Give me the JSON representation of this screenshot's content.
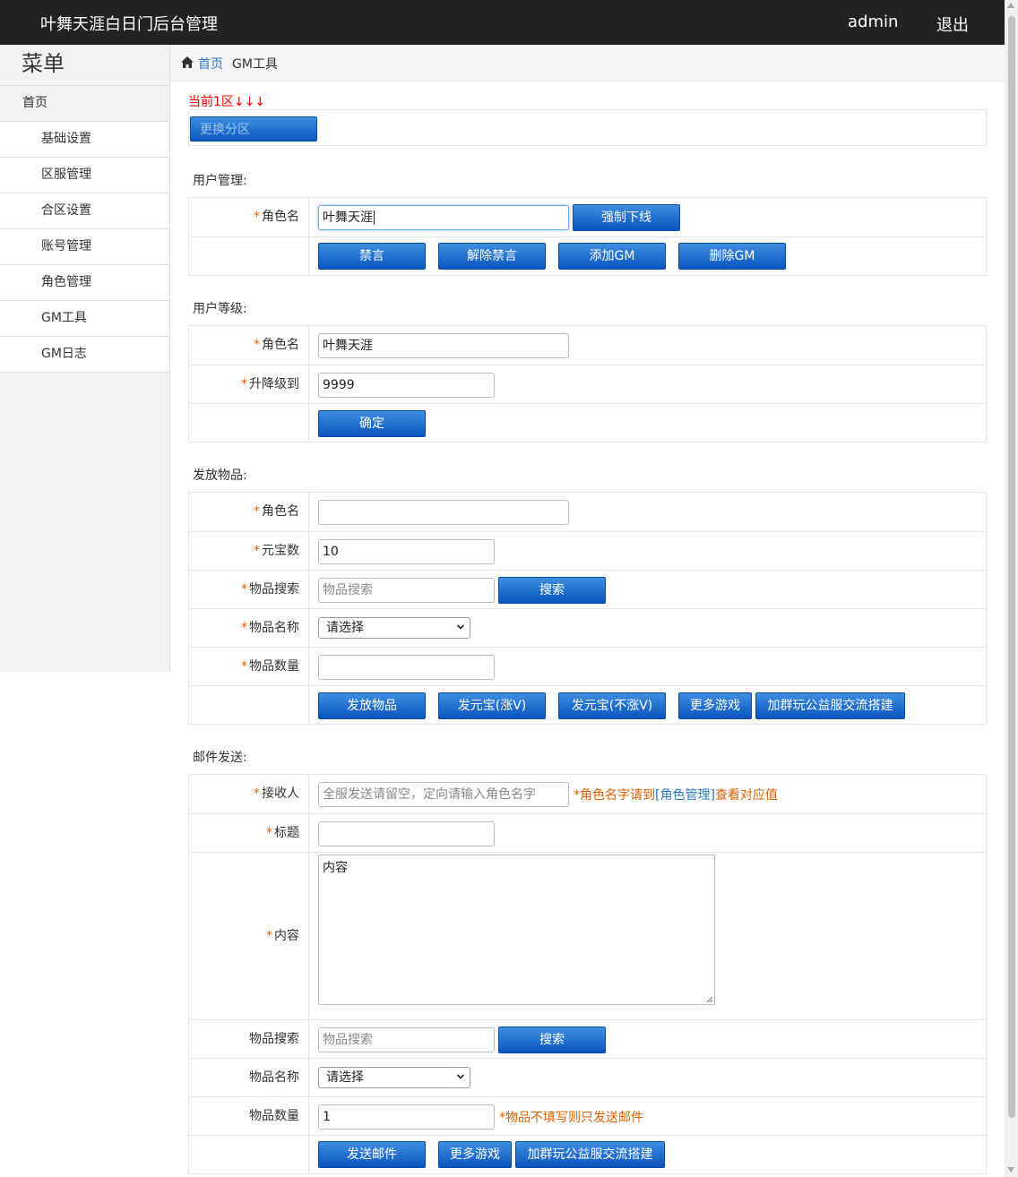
{
  "header": {
    "title": "叶舞天涯白日门后台管理",
    "user": "admin",
    "logout": "退出"
  },
  "sidebar": {
    "title": "菜单",
    "items": [
      {
        "label": "首页"
      },
      {
        "label": "基础设置"
      },
      {
        "label": "区服管理"
      },
      {
        "label": "合区设置"
      },
      {
        "label": "账号管理"
      },
      {
        "label": "角色管理"
      },
      {
        "label": "GM工具"
      },
      {
        "label": "GM日志"
      }
    ]
  },
  "breadcrumb": {
    "home": "首页",
    "current": "GM工具"
  },
  "zone": {
    "note": "当前1区↓↓↓",
    "button": "更换分区"
  },
  "user_mgmt": {
    "title": "用户管理:",
    "role_label": "角色名",
    "role_value": "叶舞天涯",
    "kick_button": "强制下线",
    "buttons": [
      "禁言",
      "解除禁言",
      "添加GM",
      "删除GM"
    ]
  },
  "user_level": {
    "title": "用户等级:",
    "role_label": "角色名",
    "role_value": "叶舞天涯",
    "level_label": "升降级到",
    "level_value": "9999",
    "confirm_button": "确定"
  },
  "items": {
    "title": "发放物品:",
    "role_label": "角色名",
    "role_value": "",
    "yb_label": "元宝数",
    "yb_value": "10",
    "search_label": "物品搜索",
    "search_placeholder": "物品搜索",
    "search_button": "搜索",
    "name_label": "物品名称",
    "name_select": "请选择",
    "qty_label": "物品数量",
    "qty_value": "",
    "buttons": [
      "发放物品",
      "发元宝(涨V)",
      "发元宝(不涨V)",
      "更多游戏",
      "加群玩公益服交流搭建"
    ]
  },
  "mail": {
    "title": "邮件发送:",
    "recipient_label": "接收人",
    "recipient_placeholder": "全服发送请留空，定向请输入角色名字",
    "recipient_hint_pre": "*角色名字请到",
    "recipient_hint_link": "[角色管理]",
    "recipient_hint_post": "查看对应值",
    "subject_label": "标题",
    "subject_value": "",
    "content_label": "内容",
    "content_value": "内容",
    "search_label": "物品搜索",
    "search_placeholder": "物品搜索",
    "search_button": "搜索",
    "name_label": "物品名称",
    "name_select": "请选择",
    "qty_label": "物品数量",
    "qty_value": "1",
    "qty_hint": "*物品不填写则只发送邮件",
    "buttons": [
      "发送邮件",
      "更多游戏",
      "加群玩公益服交流搭建"
    ]
  }
}
